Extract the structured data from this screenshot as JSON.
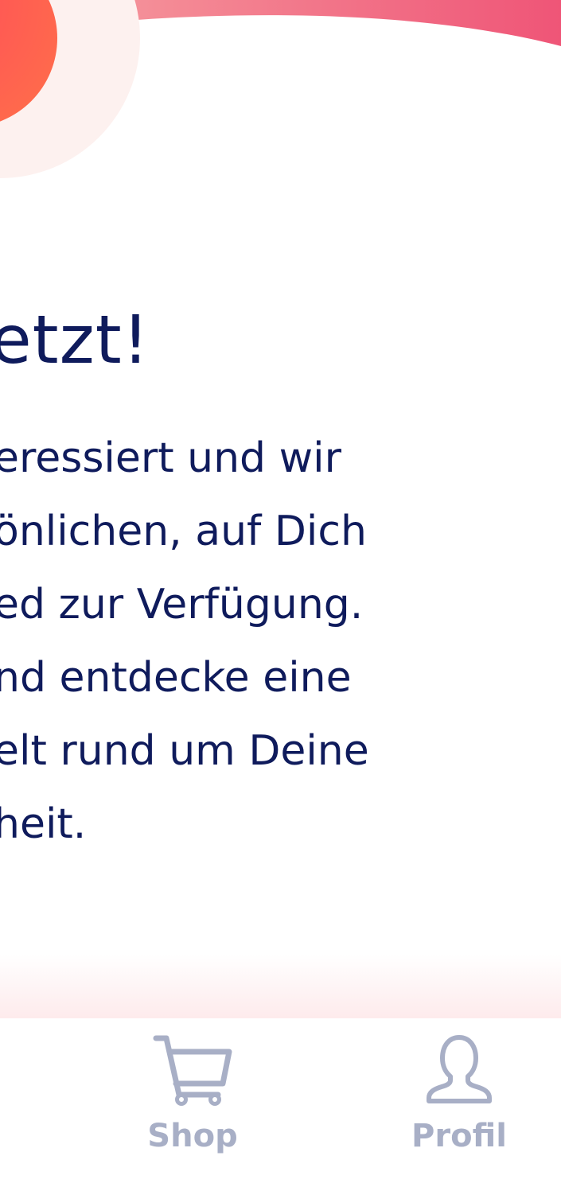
{
  "content": {
    "headline": "etzt!",
    "body_lines": [
      "eressiert und wir",
      "önlichen, auf Dich",
      "ed zur Verfügung.",
      "nd entdecke eine",
      "elt rund um Deine",
      "heit."
    ]
  },
  "bottom_nav": {
    "items": [
      {
        "label": "Shop",
        "icon": "cart-icon"
      },
      {
        "label": "Profil",
        "icon": "user-icon"
      }
    ]
  },
  "colors": {
    "text_primary": "#0f1b5c",
    "nav_inactive": "#a8afc6",
    "accent_coral": "#ff5f52",
    "accent_pink": "#ef5575"
  }
}
